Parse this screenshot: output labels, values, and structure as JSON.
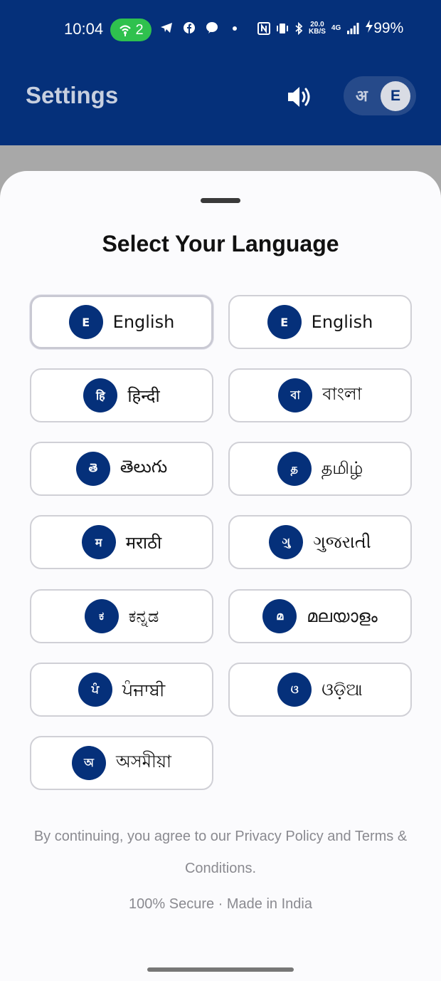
{
  "status_bar": {
    "time": "10:04",
    "hotspot_count": "2",
    "speed_top": "20.0",
    "speed_bottom": "KB/S",
    "network": "4G",
    "battery": "99%"
  },
  "header": {
    "title": "Settings",
    "toggle_left": "अ",
    "toggle_knob": "E"
  },
  "sheet": {
    "title": "Select Your Language",
    "languages": [
      {
        "badge": "E",
        "label": "English"
      },
      {
        "badge": "E",
        "label": "English"
      },
      {
        "badge": "हि",
        "label": "हिन्दी"
      },
      {
        "badge": "বা",
        "label": "বাংলা"
      },
      {
        "badge": "తె",
        "label": "తెలుగు"
      },
      {
        "badge": "த",
        "label": "தமிழ்"
      },
      {
        "badge": "म",
        "label": "मराठी"
      },
      {
        "badge": "ગુ",
        "label": "ગુજરાતી"
      },
      {
        "badge": "ಕ",
        "label": "ಕನ್ನಡ"
      },
      {
        "badge": "മ",
        "label": "മലയാളം"
      },
      {
        "badge": "ਪੰ",
        "label": "ਪੰਜਾਬੀ"
      },
      {
        "badge": "ଓ",
        "label": "ଓଡ଼ିଆ"
      },
      {
        "badge": "অ",
        "label": "অসমীয়া"
      }
    ],
    "terms": "By continuing, you agree to our Privacy Policy and Terms & Conditions.",
    "secure": "100% Secure · Made in India"
  },
  "colors": {
    "brand": "#05307a",
    "hotspot": "#2fc14e"
  }
}
